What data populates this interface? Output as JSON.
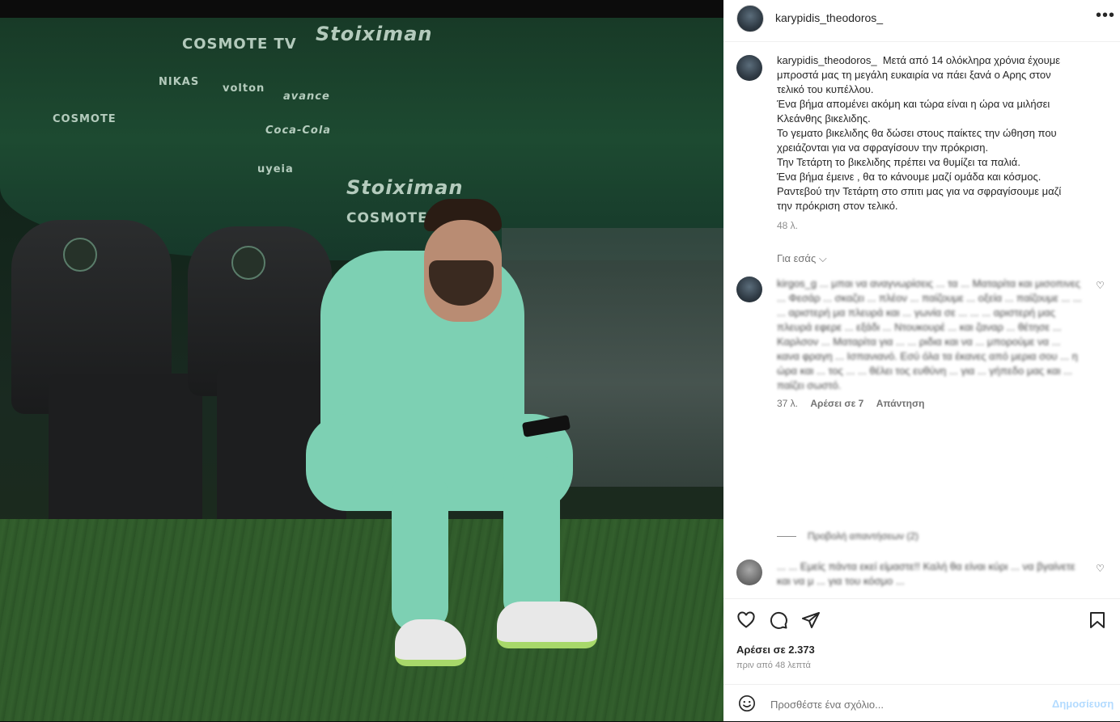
{
  "post": {
    "username": "karypidis_theodoros_",
    "more_icon": "more-horizontal-icon"
  },
  "caption": {
    "username": "karypidis_theodoros_",
    "lines": [
      "Μετά από 14 ολόκληρα χρόνια έχουμε",
      "μπροστά μας τη μεγάλη ευκαιρία να πάει ξανά ο Αρης στον",
      "τελικό του κυπέλλου.",
      "Ένα βήμα απομένει ακόμη και τώρα είναι η ώρα να μιλήσει",
      "Κλεάνθης βικελιδης.",
      "Το γεματο βικελιδης θα δώσει στους παίκτες την ώθηση που",
      "χρειάζονται για να σφραγίσουν την πρόκριση.",
      "Την Τετάρτη το βικελιδης πρέπει να θυμίζει τα παλιά.",
      "Ένα βήμα έμεινε , θα το κάνουμε μαζί ομάδα και κόσμος.",
      "Ραντεβού την Τετάρτη στο σπιτι μας για να σφραγίσουμε μαζί",
      "την πρόκριση στον τελικό."
    ],
    "time": "48 λ.",
    "translate": "Για εσάς ⌵"
  },
  "comments": [
    {
      "text": "kirgos_g ... μπαι να αναγνωρίσεις ... τα ... Ματαρίτα και μισοπινες ... Φεσάρ ... σκαζει ... πλέον ... παίζουμε ... οξεία ... παίζουμε ... ... ... αριστερή μα πλευρά και ... γωνία σε ... ... ... αριστερή μας πλευρά εφερε ... εξάδι ... Ντουκουρέ ... και ζαναρ ... θέτησε ... Καρλσον ... Ματαρίτα για ... ... ριδια και να ... μπορούμε να ... κανα φραγη ... Ισπανιανό. Εσύ όλα τα έκανες από μερια σου ... η ώρα και ... τος ... ... θέλει τος ευθύνη ... για ... γήπεδο μας και ... παίζει σωστό.",
      "time": "37 λ.",
      "likes": "Αρέσει σε 7",
      "reply": "Απάντηση",
      "view_replies": "Προβολή απαντήσεων (2)"
    },
    {
      "text": "... ... Εμείς πάντα εκεί είμαστε!! Καλή θα είναι κύρι ... να βγαίνετε και να μ ... για του κόσμο ..."
    }
  ],
  "actions": {
    "like_icon": "heart-icon",
    "comment_icon": "comment-icon",
    "share_icon": "send-icon",
    "save_icon": "bookmark-icon"
  },
  "likes_text": "Αρέσει σε 2.373",
  "posted_ago": "πριν από 48 λεπτά",
  "add_comment": {
    "placeholder": "Προσθέστε ένα σχόλιο...",
    "post_label": "Δημοσίευση"
  },
  "photo": {
    "sponsors": [
      "COSMOTE TV",
      "Stoiximan",
      "NIKAS",
      "volton",
      "avance",
      "COSMOTE",
      "Coca-Cola",
      "uyeia",
      "COSMOTE TV",
      "Stoiximan"
    ]
  }
}
